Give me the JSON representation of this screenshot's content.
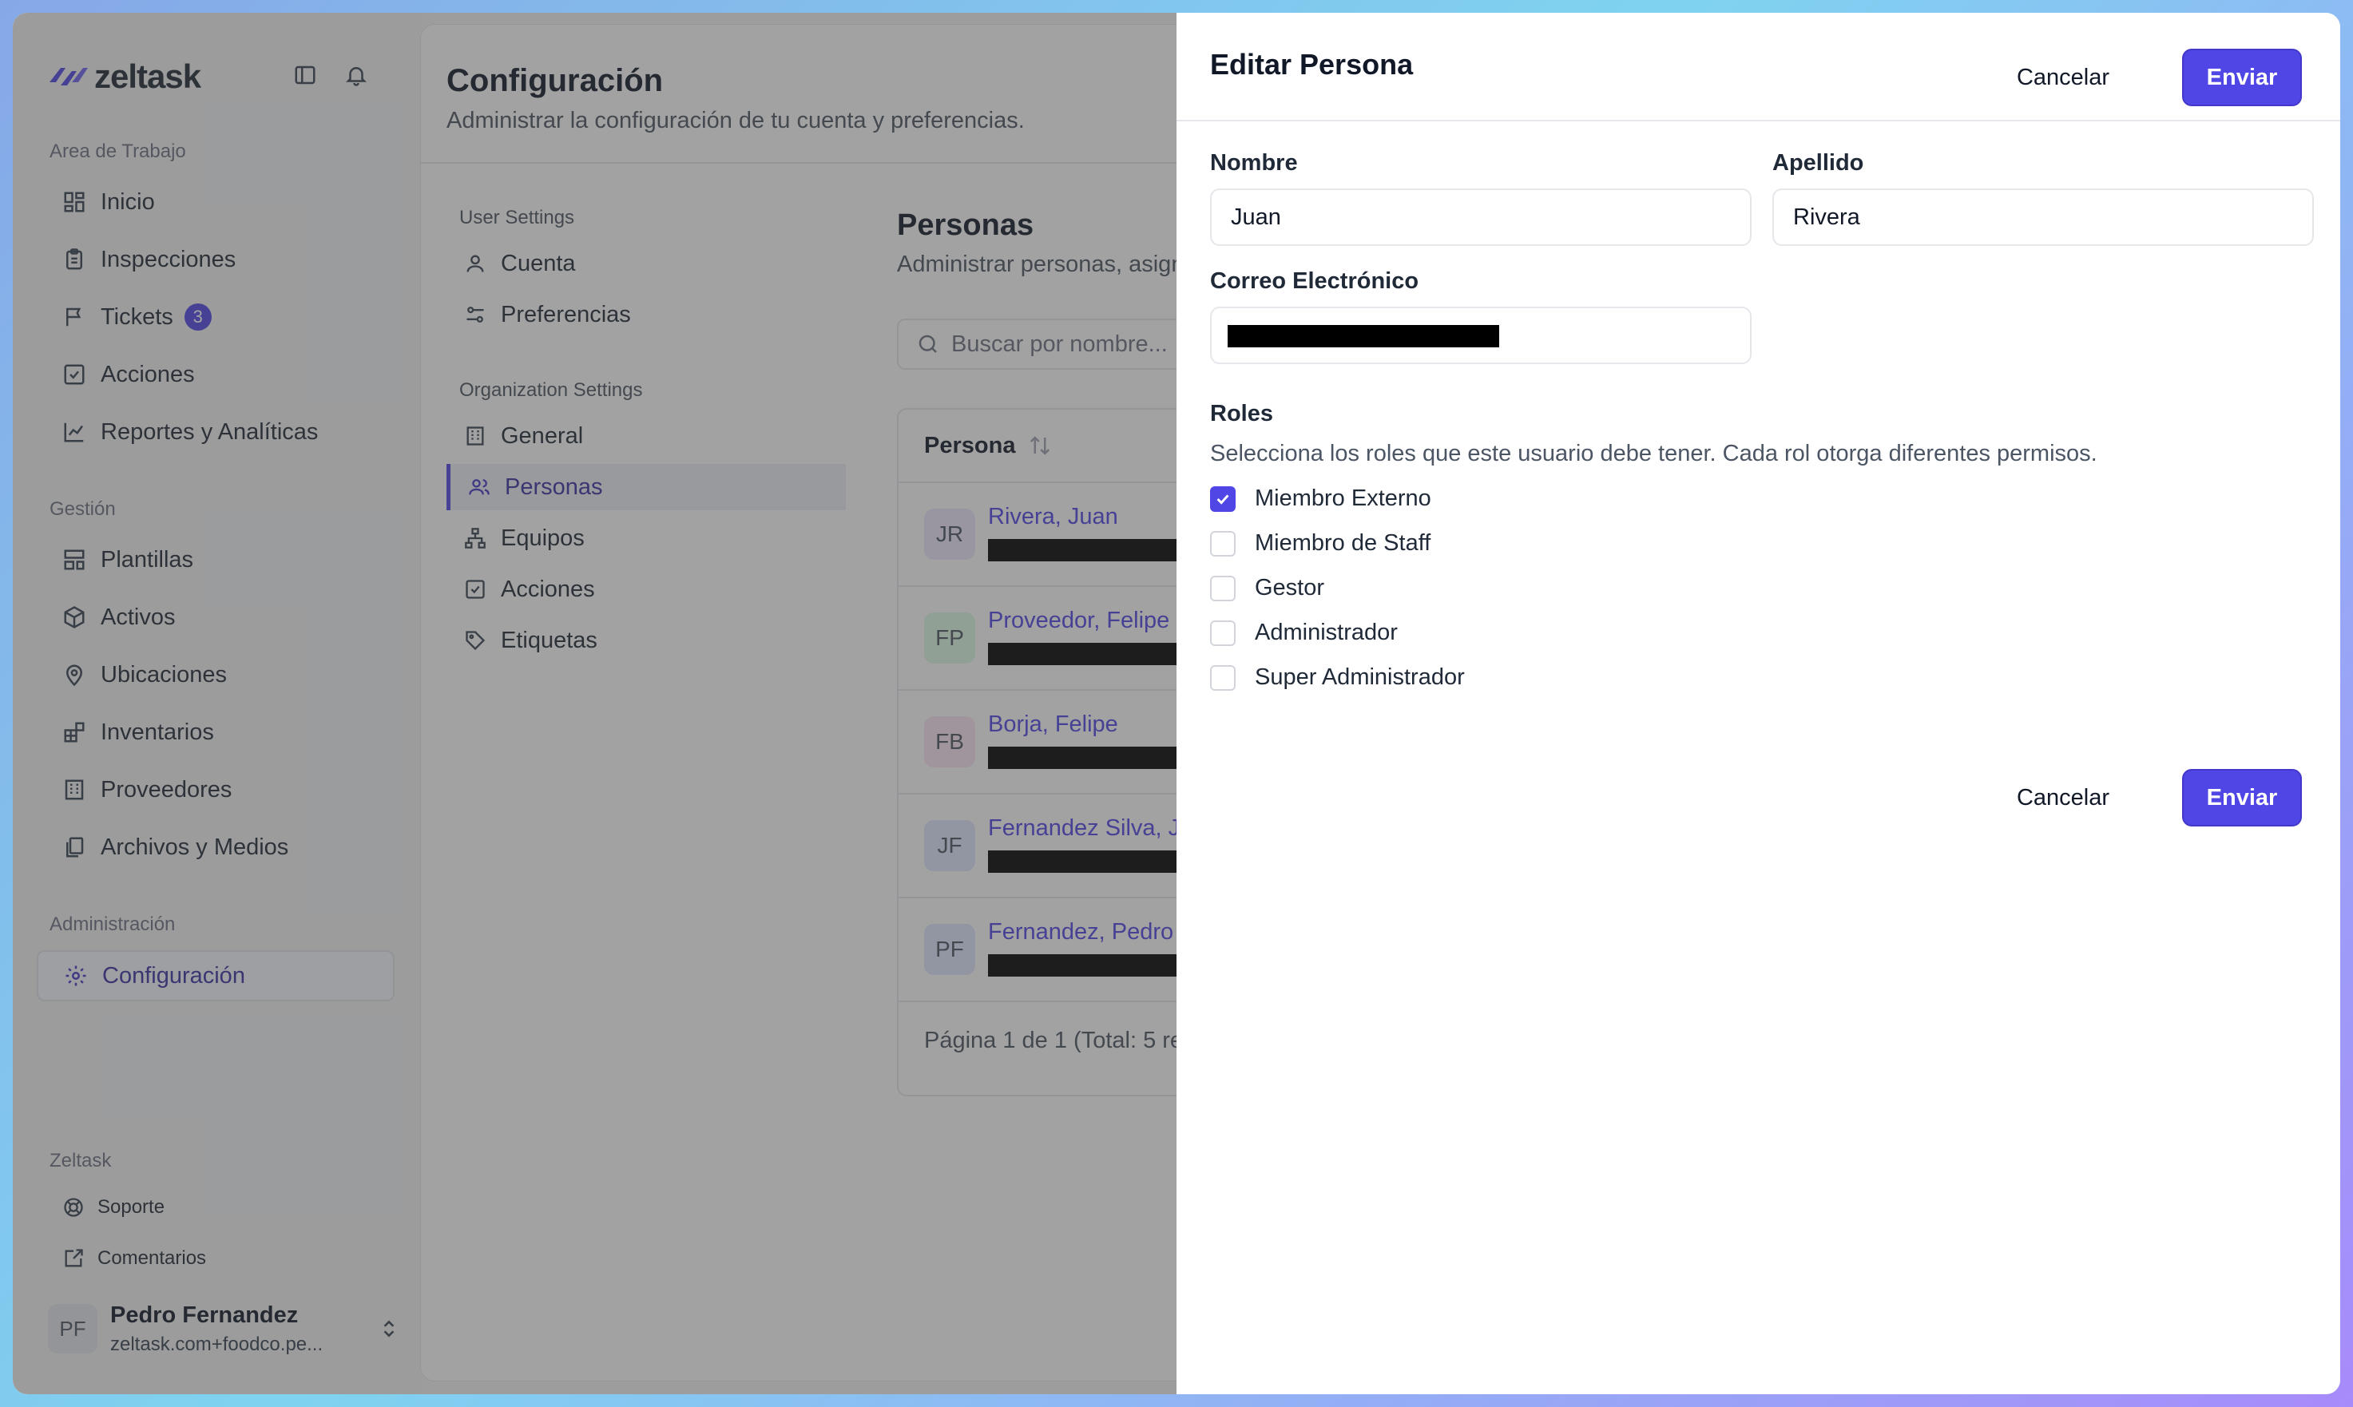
{
  "brand": {
    "name": "zeltask"
  },
  "sidebar": {
    "workspace_label": "Area de Trabajo",
    "workspace_items": [
      {
        "label": "Inicio",
        "icon": "dashboard-icon"
      },
      {
        "label": "Inspecciones",
        "icon": "clipboard-icon"
      },
      {
        "label": "Tickets",
        "icon": "flag-icon",
        "badge": "3"
      },
      {
        "label": "Acciones",
        "icon": "check-square-icon"
      },
      {
        "label": "Reportes y Analíticas",
        "icon": "chart-line-icon"
      }
    ],
    "management_label": "Gestión",
    "management_items": [
      {
        "label": "Plantillas",
        "icon": "template-icon"
      },
      {
        "label": "Activos",
        "icon": "box-icon"
      },
      {
        "label": "Ubicaciones",
        "icon": "map-pin-icon"
      },
      {
        "label": "Inventarios",
        "icon": "blocks-icon"
      },
      {
        "label": "Proveedores",
        "icon": "building-icon"
      },
      {
        "label": "Archivos y Medios",
        "icon": "files-icon"
      }
    ],
    "admin_label": "Administración",
    "admin_items": [
      {
        "label": "Configuración",
        "icon": "gear-icon",
        "active": true
      }
    ],
    "footer_label": "Zeltask",
    "footer_items": [
      {
        "label": "Soporte",
        "icon": "lifebuoy-icon"
      },
      {
        "label": "Comentarios",
        "icon": "feedback-icon"
      }
    ],
    "user": {
      "initials": "PF",
      "name": "Pedro Fernandez",
      "email": "zeltask.com+foodco.pe..."
    }
  },
  "main": {
    "title": "Configuración",
    "subtitle": "Administrar la configuración de tu cuenta y preferencias.",
    "user_settings_label": "User Settings",
    "user_settings": [
      {
        "label": "Cuenta",
        "icon": "user-icon"
      },
      {
        "label": "Preferencias",
        "icon": "sliders-icon"
      }
    ],
    "org_settings_label": "Organization Settings",
    "org_settings": [
      {
        "label": "General",
        "icon": "building-icon"
      },
      {
        "label": "Personas",
        "icon": "users-icon",
        "active": true
      },
      {
        "label": "Equipos",
        "icon": "hierarchy-icon"
      },
      {
        "label": "Acciones",
        "icon": "check-square-icon"
      },
      {
        "label": "Etiquetas",
        "icon": "tag-icon"
      }
    ],
    "people": {
      "title": "Personas",
      "subtitle": "Administrar personas, asign",
      "search_placeholder": "Buscar por nombre...",
      "column_person": "Persona",
      "rows": [
        {
          "initials": "JR",
          "name": "Rivera, Juan",
          "color": "#ede9fe"
        },
        {
          "initials": "FP",
          "name": "Proveedor, Felipe",
          "color": "#dcfce7"
        },
        {
          "initials": "FB",
          "name": "Borja, Felipe",
          "color": "#fce7f3"
        },
        {
          "initials": "JF",
          "name": "Fernandez Silva, J",
          "color": "#e0e7ff"
        },
        {
          "initials": "PF",
          "name": "Fernandez, Pedro",
          "color": "#e0e7ff"
        }
      ],
      "footer": "Página 1 de 1 (Total: 5 re"
    }
  },
  "drawer": {
    "title": "Editar Persona",
    "cancel_label": "Cancelar",
    "submit_label": "Enviar",
    "first_name_label": "Nombre",
    "first_name_value": "Juan",
    "last_name_label": "Apellido",
    "last_name_value": "Rivera",
    "email_label": "Correo Electrónico",
    "roles_label": "Roles",
    "roles_description": "Selecciona los roles que este usuario debe tener. Cada rol otorga diferentes permisos.",
    "roles": [
      {
        "label": "Miembro Externo",
        "checked": true
      },
      {
        "label": "Miembro de Staff",
        "checked": false
      },
      {
        "label": "Gestor",
        "checked": false
      },
      {
        "label": "Administrador",
        "checked": false
      },
      {
        "label": "Super Administrador",
        "checked": false
      }
    ]
  },
  "colors": {
    "accent": "#4f46e5",
    "link": "#4f46e5"
  }
}
